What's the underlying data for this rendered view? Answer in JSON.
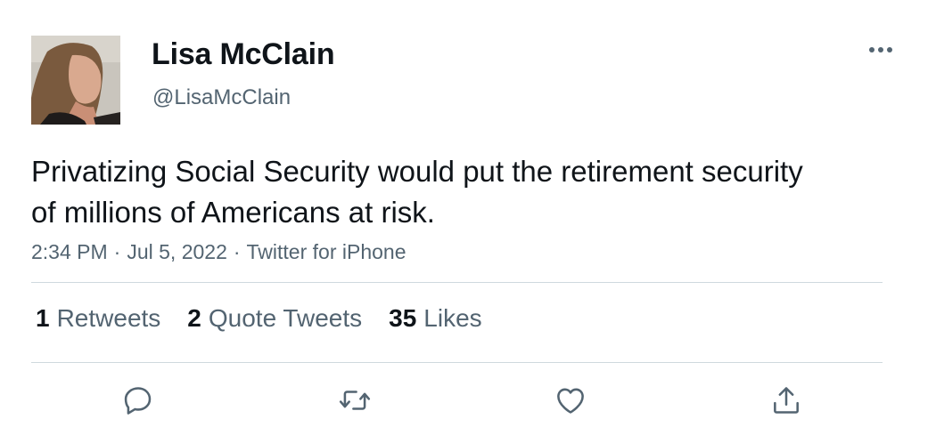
{
  "author": {
    "display_name": "Lisa McClain",
    "handle": "@LisaMcClain",
    "avatar_icon": "profile-photo"
  },
  "tweet": {
    "text": "Privatizing Social Security would put the retirement security of millions of Americans at risk.",
    "time": "2:34 PM",
    "date": "Jul 5, 2022",
    "source": "Twitter for iPhone",
    "separator": "·"
  },
  "stats": {
    "retweets": {
      "count": "1",
      "label": "Retweets"
    },
    "quote_tweets": {
      "count": "2",
      "label": "Quote Tweets"
    },
    "likes": {
      "count": "35",
      "label": "Likes"
    }
  },
  "actions": [
    "reply-icon",
    "retweet-icon",
    "like-icon",
    "share-icon"
  ],
  "colors": {
    "text_primary": "#0f1419",
    "text_secondary": "#536471",
    "divider": "#cfd9de"
  }
}
